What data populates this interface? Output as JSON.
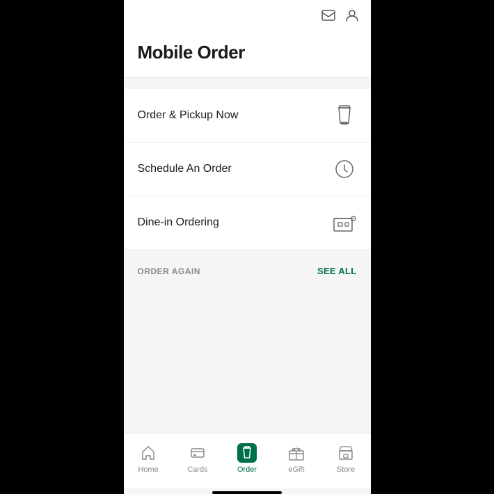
{
  "statusBar": {
    "mailIcon": "✉",
    "userIcon": "👤"
  },
  "header": {
    "title": "Mobile Order"
  },
  "options": [
    {
      "id": "pickup",
      "label": "Order & Pickup Now",
      "iconType": "cup"
    },
    {
      "id": "schedule",
      "label": "Schedule An Order",
      "iconType": "clock"
    },
    {
      "id": "dinein",
      "label": "Dine-in Ordering",
      "iconType": "store"
    }
  ],
  "orderAgain": {
    "title": "ORDER AGAIN",
    "seeAll": "SEE ALL"
  },
  "bottomNav": [
    {
      "id": "home",
      "label": "Home",
      "active": false
    },
    {
      "id": "cards",
      "label": "Cards",
      "active": false
    },
    {
      "id": "order",
      "label": "Order",
      "active": true
    },
    {
      "id": "egift",
      "label": "eGift",
      "active": false
    },
    {
      "id": "store",
      "label": "Store",
      "active": false
    }
  ]
}
